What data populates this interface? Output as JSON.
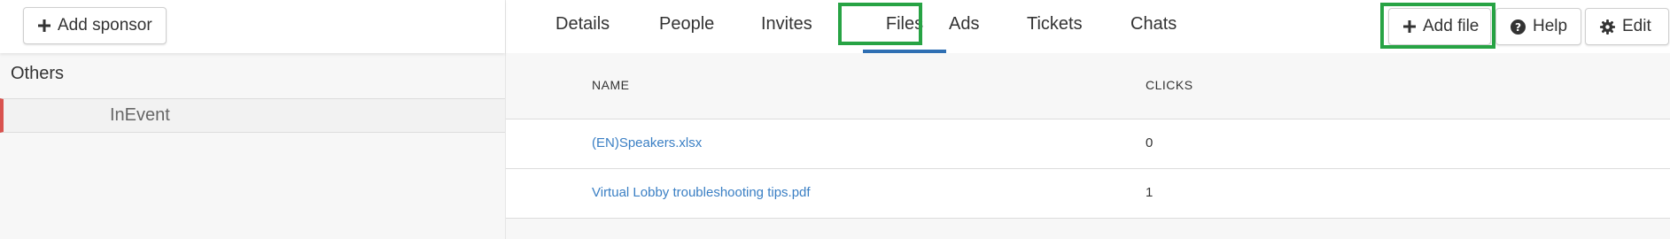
{
  "left": {
    "add_sponsor_label": "Add sponsor",
    "group_title": "Others",
    "sponsors": [
      {
        "name": "InEvent"
      }
    ]
  },
  "tabs": [
    {
      "label": "Details"
    },
    {
      "label": "People"
    },
    {
      "label": "Invites"
    },
    {
      "label": "Files"
    },
    {
      "label": "Ads"
    },
    {
      "label": "Tickets"
    },
    {
      "label": "Chats"
    }
  ],
  "active_tab": "Files",
  "actions": {
    "add_file_label": "Add file",
    "help_label": "Help",
    "edit_label": "Edit"
  },
  "table": {
    "headers": {
      "name": "NAME",
      "clicks": "CLICKS"
    },
    "rows": [
      {
        "name": "(EN)Speakers.xlsx",
        "clicks": "0"
      },
      {
        "name": "Virtual Lobby troubleshooting tips.pdf",
        "clicks": "1"
      }
    ]
  },
  "colors": {
    "active_tab_underline": "#2f6fb3",
    "highlight": "#27a344",
    "link": "#3a7fc4",
    "selected_marker": "#d9534f"
  },
  "icons": {
    "add_sponsor": "plus-icon",
    "add_file": "plus-icon",
    "help": "question-circle-icon",
    "edit": "gear-icon"
  }
}
